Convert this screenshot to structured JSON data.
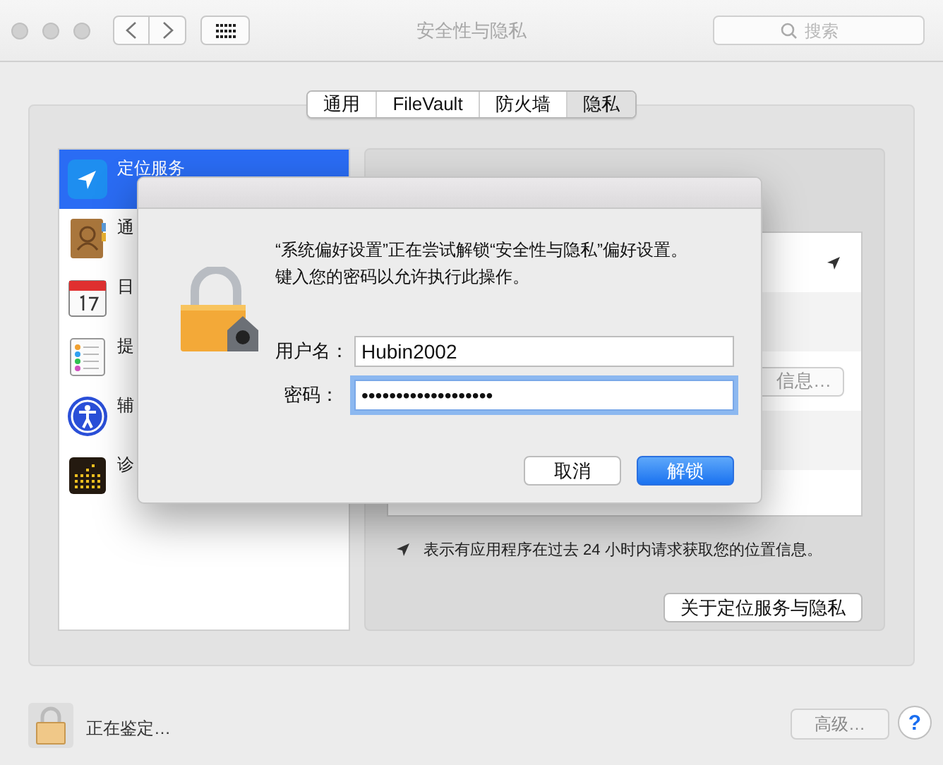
{
  "window": {
    "title": "安全性与隐私",
    "search": {
      "placeholder": "搜索"
    }
  },
  "tabs": [
    {
      "label": "通用",
      "selected": false
    },
    {
      "label": "FileVault",
      "selected": false
    },
    {
      "label": "防火墙",
      "selected": false
    },
    {
      "label": "隐私",
      "selected": true
    }
  ],
  "sidebar": {
    "items": [
      {
        "label": "定位服务",
        "selected": true
      },
      {
        "label": "通",
        "selected": false
      },
      {
        "label": "日",
        "selected": false
      },
      {
        "label": "提",
        "selected": false
      },
      {
        "label": "辅",
        "selected": false
      },
      {
        "label": "诊",
        "selected": false
      }
    ]
  },
  "location_panel": {
    "details_button": "信息…",
    "note": "表示有应用程序在过去 24 小时内请求获取您的位置信息。",
    "about_button": "关于定位服务与隐私"
  },
  "footer": {
    "lock_status": "正在鉴定…",
    "advanced_button": "高级…",
    "help_button": "?"
  },
  "dialog": {
    "message": [
      "“系统偏好设置”正在尝试解锁“安全性与隐私”偏好设置。",
      "键入您的密码以允许执行此操作。"
    ],
    "fields": [
      {
        "label": "用户名：",
        "value": "Hubin2002",
        "focused": false
      },
      {
        "label": "密码：",
        "value": "•••••••••••••••••••",
        "focused": true
      }
    ],
    "buttons": [
      {
        "label": "取消",
        "default": false
      },
      {
        "label": "解锁",
        "default": true
      }
    ]
  }
}
